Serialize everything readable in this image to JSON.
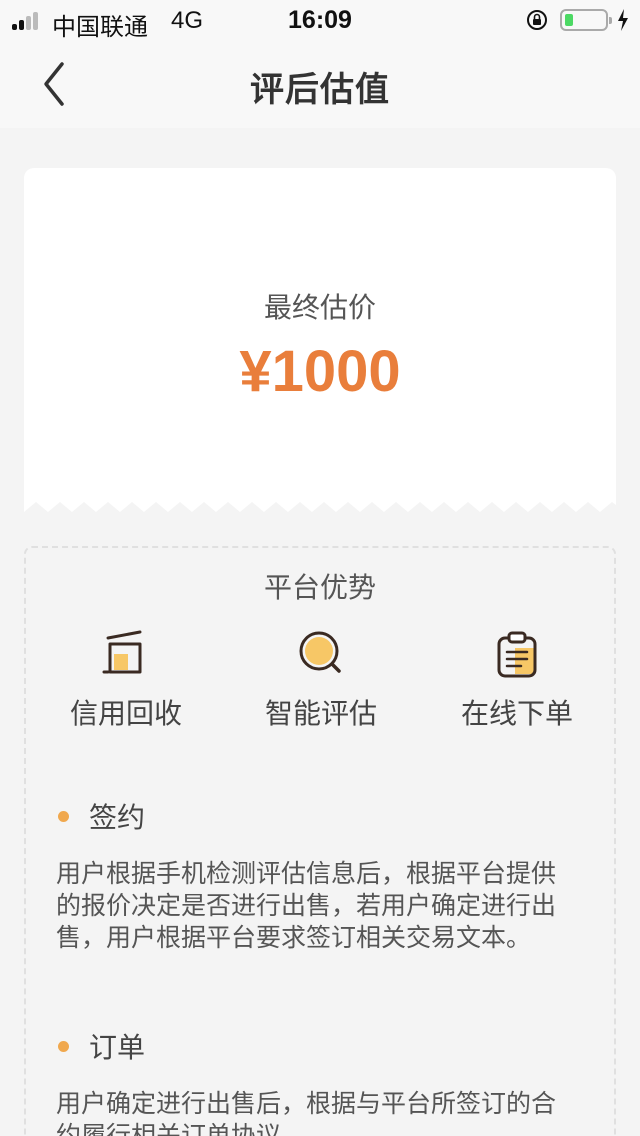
{
  "status_bar": {
    "carrier": "中国联通",
    "network": "4G",
    "time": "16:09",
    "battery_level": 0.2
  },
  "nav": {
    "title": "评后估值",
    "back_icon": "chevron-left-icon"
  },
  "price": {
    "label": "最终估价",
    "value": "¥1000"
  },
  "advantages": {
    "title": "平台优势",
    "features": [
      {
        "label": "信用回收",
        "icon": "trash-bin-icon"
      },
      {
        "label": "智能评估",
        "icon": "magnifier-icon"
      },
      {
        "label": "在线下单",
        "icon": "clipboard-icon"
      }
    ]
  },
  "sections": [
    {
      "title": "签约",
      "text": "用户根据手机检测评估信息后，根据平台提供的报价决定是否进行出售，若用户确定进行出售，用户根据平台要求签订相关交易文本。"
    },
    {
      "title": "订单",
      "text": "用户确定进行出售后，根据与平台所签订的合约履行相关订单协议"
    }
  ],
  "colors": {
    "accent": "#e97e3b",
    "icon_fill": "#f7c766",
    "bullet": "#f0a84e",
    "background": "#f4f4f4"
  }
}
